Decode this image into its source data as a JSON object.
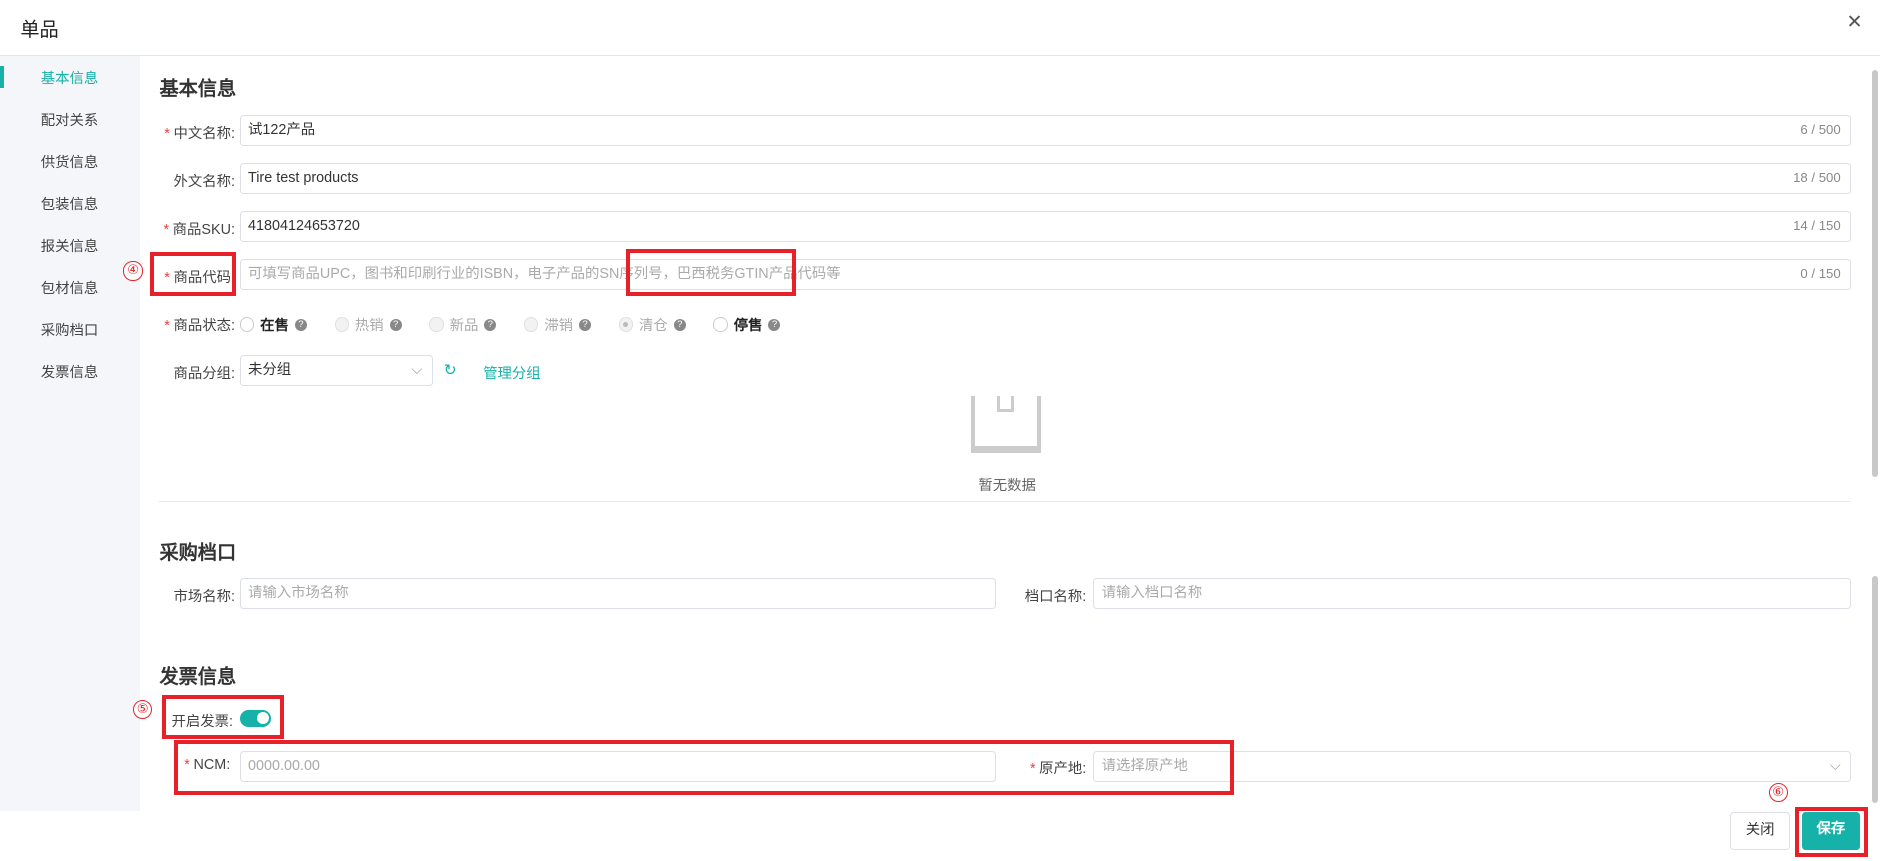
{
  "dialog": {
    "title": "单品",
    "close_icon": "close-icon"
  },
  "sidebar": {
    "items": [
      {
        "label": "基本信息",
        "active": true
      },
      {
        "label": "配对关系"
      },
      {
        "label": "供货信息"
      },
      {
        "label": "包装信息"
      },
      {
        "label": "报关信息"
      },
      {
        "label": "包材信息"
      },
      {
        "label": "采购档口"
      },
      {
        "label": "发票信息"
      }
    ]
  },
  "basic": {
    "heading": "基本信息",
    "cn_name": {
      "label": "中文名称:",
      "value": "试122产品",
      "count": "6 / 500"
    },
    "foreign_name": {
      "label": "外文名称:",
      "value": "Tire test products",
      "count": "18 / 500"
    },
    "sku": {
      "label": "商品SKU:",
      "value": "41804124653720",
      "count": "14 / 150"
    },
    "code": {
      "label": "商品代码:",
      "placeholder": "可填写商品UPC，图书和印刷行业的ISBN，电子产品的SN序列号，巴西税务GTIN产品代码等",
      "count": "0 / 150"
    },
    "status": {
      "label": "商品状态:",
      "options": [
        "在售",
        "热销",
        "新品",
        "滞销",
        "清仓",
        "停售"
      ],
      "help": "?"
    },
    "group": {
      "label": "商品分组:",
      "value": "未分组",
      "manage": "管理分组"
    },
    "empty": "暂无数据"
  },
  "purchase": {
    "heading": "采购档口",
    "market": {
      "label": "市场名称:",
      "placeholder": "请输入市场名称"
    },
    "stall": {
      "label": "档口名称:",
      "placeholder": "请输入档口名称"
    }
  },
  "invoice": {
    "heading": "发票信息",
    "enable": {
      "label": "开启发票:",
      "on": true
    },
    "ncm": {
      "label": "NCM:",
      "placeholder": "0000.00.00"
    },
    "origin": {
      "label": "原产地:",
      "placeholder": "请选择原产地"
    }
  },
  "footer": {
    "close": "关闭",
    "save": "保存"
  },
  "annotations": [
    "④",
    "⑤",
    "⑥"
  ],
  "colors": {
    "accent": "#16b1a9",
    "annotation": "#e8202a"
  }
}
